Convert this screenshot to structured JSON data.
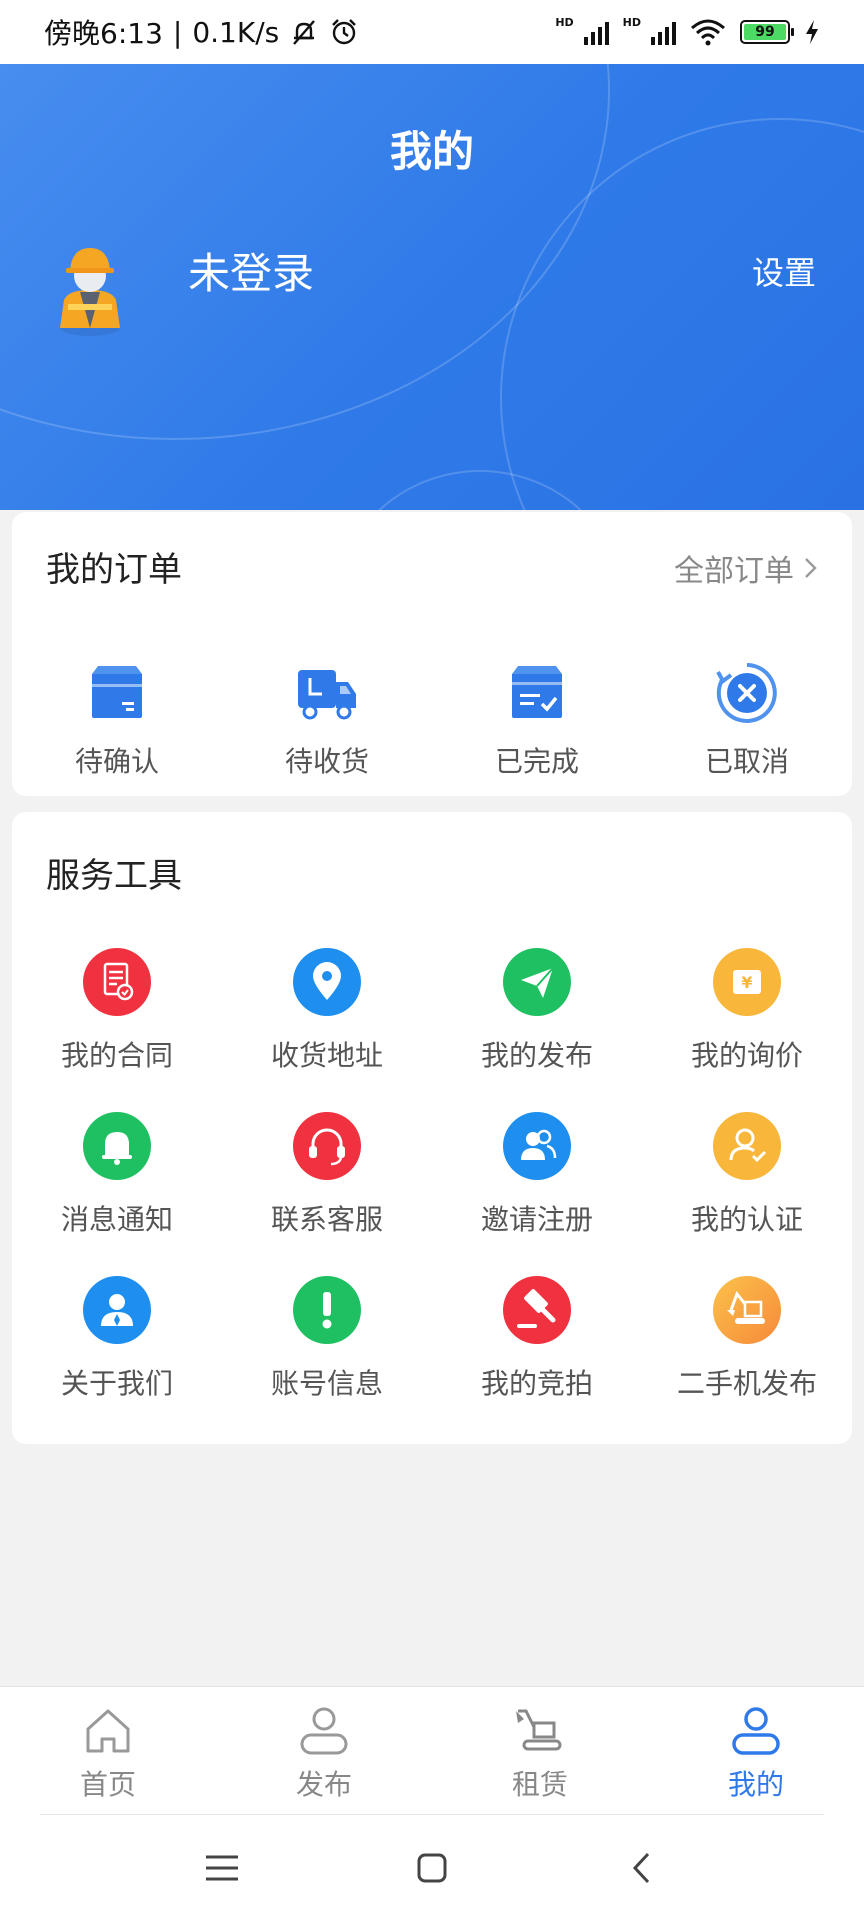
{
  "status_bar": {
    "time": "傍晚6:13",
    "speed": "0.1K/s",
    "battery": "99"
  },
  "header": {
    "title": "我的",
    "username": "未登录",
    "settings_label": "设置"
  },
  "orders": {
    "title": "我的订单",
    "all_label": "全部订单",
    "items": [
      {
        "label": "待确认",
        "icon": "box-icon"
      },
      {
        "label": "待收货",
        "icon": "truck-icon"
      },
      {
        "label": "已完成",
        "icon": "completed-box-icon"
      },
      {
        "label": "已取消",
        "icon": "cancel-icon"
      }
    ]
  },
  "tools": {
    "title": "服务工具",
    "items": [
      {
        "label": "我的合同",
        "icon": "contract-icon",
        "color": "#f0313f"
      },
      {
        "label": "收货地址",
        "icon": "location-icon",
        "color": "#1e8fef"
      },
      {
        "label": "我的发布",
        "icon": "send-icon",
        "color": "#1fc062"
      },
      {
        "label": "我的询价",
        "icon": "yuan-icon",
        "color": "#f8b63b"
      },
      {
        "label": "消息通知",
        "icon": "bell-icon",
        "color": "#1fc062"
      },
      {
        "label": "联系客服",
        "icon": "headset-icon",
        "color": "#f0313f"
      },
      {
        "label": "邀请注册",
        "icon": "invite-users-icon",
        "color": "#1e8fef"
      },
      {
        "label": "我的认证",
        "icon": "verified-user-icon",
        "color": "#f8b63b"
      },
      {
        "label": "关于我们",
        "icon": "about-user-icon",
        "color": "#1e8fef"
      },
      {
        "label": "账号信息",
        "icon": "exclamation-icon",
        "color": "#1fc062"
      },
      {
        "label": "我的竞拍",
        "icon": "auction-hammer-icon",
        "color": "#f0313f"
      },
      {
        "label": "二手机发布",
        "icon": "excavator-icon",
        "color": "#f8a43a"
      }
    ]
  },
  "bottom_nav": {
    "items": [
      {
        "label": "首页",
        "icon": "home-icon",
        "active": false
      },
      {
        "label": "发布",
        "icon": "person-icon",
        "active": false
      },
      {
        "label": "租赁",
        "icon": "excavator-icon",
        "active": false
      },
      {
        "label": "我的",
        "icon": "person-icon",
        "active": true
      }
    ]
  },
  "colors": {
    "primary": "#2f7ae8",
    "text_muted": "#888888"
  }
}
